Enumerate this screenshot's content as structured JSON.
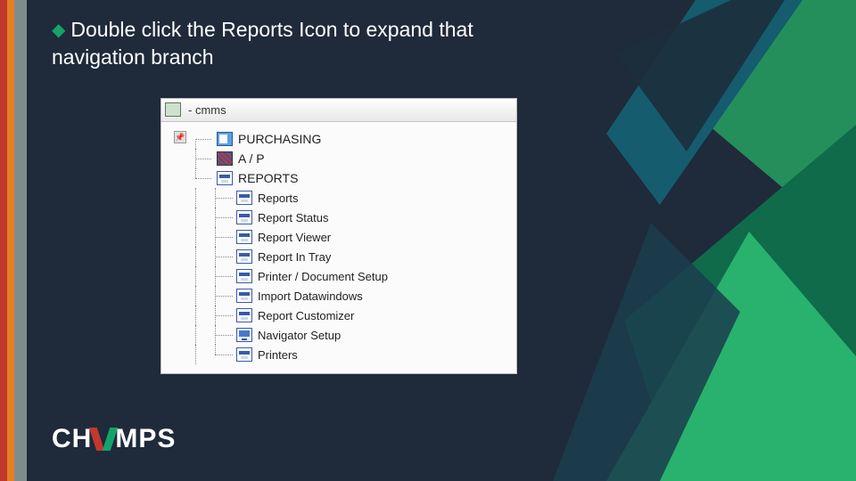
{
  "heading": {
    "text": "Double click the Reports Icon to expand that navigation branch"
  },
  "window": {
    "title": "- cmms"
  },
  "tree": {
    "top": [
      {
        "label": "PURCHASING",
        "icon": "sheet"
      },
      {
        "label": "A / P",
        "icon": "stripes"
      },
      {
        "label": "REPORTS",
        "icon": "printer"
      }
    ],
    "reports_children": [
      {
        "label": "Reports",
        "icon": "printer"
      },
      {
        "label": "Report Status",
        "icon": "printer"
      },
      {
        "label": "Report Viewer",
        "icon": "printer"
      },
      {
        "label": "Report In Tray",
        "icon": "printer"
      },
      {
        "label": "Printer / Document Setup",
        "icon": "printer"
      },
      {
        "label": "Import Datawindows",
        "icon": "printer"
      },
      {
        "label": "Report Customizer",
        "icon": "printer"
      },
      {
        "label": "Navigator Setup",
        "icon": "monitor"
      },
      {
        "label": "Printers",
        "icon": "printer"
      }
    ]
  },
  "logo": {
    "part1": "CH",
    "part2": "MPS"
  }
}
